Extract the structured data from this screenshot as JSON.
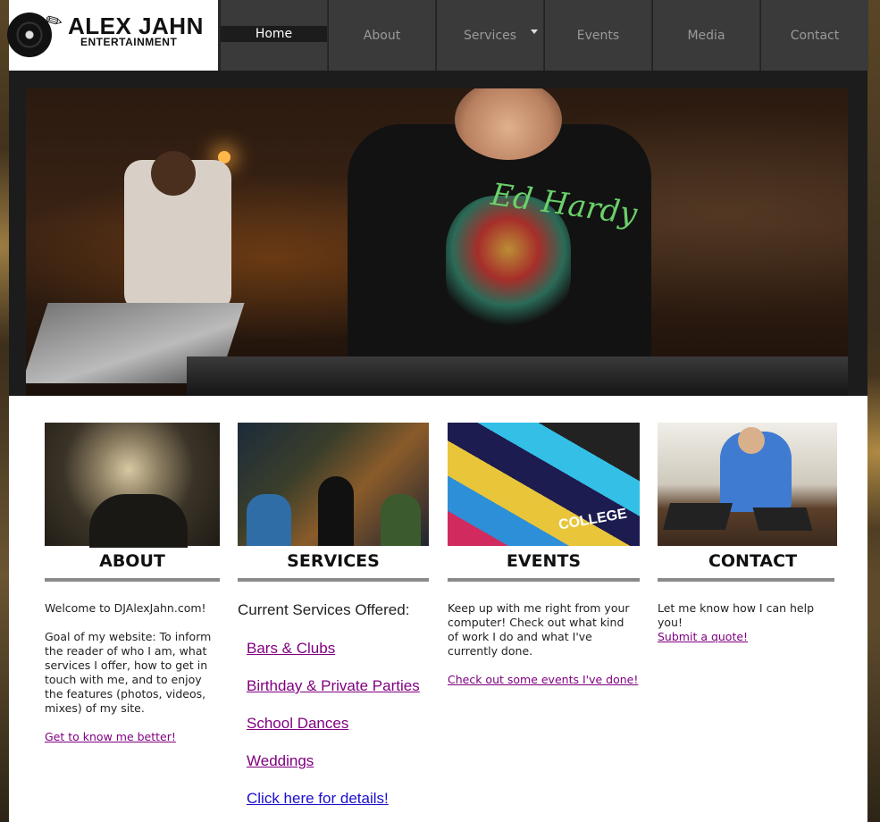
{
  "logo": {
    "line1": "ALEX JAHN",
    "line2": "ENTERTAINMENT"
  },
  "nav": {
    "items": [
      {
        "label": "Home"
      },
      {
        "label": "About"
      },
      {
        "label": "Services"
      },
      {
        "label": "Events"
      },
      {
        "label": "Media"
      },
      {
        "label": "Contact"
      }
    ]
  },
  "sections": {
    "about": {
      "title": "ABOUT",
      "intro": "Welcome to DJAlexJahn.com!",
      "body": "Goal of my website:  To inform the reader of who I am, what services I offer, how to get in touch with me, and to enjoy the features (photos, videos, mixes) of my site.",
      "link": "Get to know me better!"
    },
    "services": {
      "title": "SERVICES",
      "heading": "Current Services Offered:",
      "items": [
        "Bars & Clubs",
        "Birthday & Private Parties",
        "School Dances",
        "Weddings"
      ],
      "details_link": "Click here for details!"
    },
    "events": {
      "title": "EVENTS",
      "body": "Keep up with me right from your computer! Check out what kind of work I do and what I've currently done.",
      "link": "Check out some events I've done!",
      "thumb_caption": "COLLEGE"
    },
    "contact": {
      "title": "CONTACT",
      "body": "Let me know how I can help you!",
      "link": "Submit a quote!"
    }
  },
  "hero_graphic_text": "Ed Hardy",
  "colors": {
    "link_visited": "#800080",
    "link_blue": "#1a0dcc",
    "nav_bg": "#3a3a3a",
    "rule": "#8a8a8a"
  }
}
